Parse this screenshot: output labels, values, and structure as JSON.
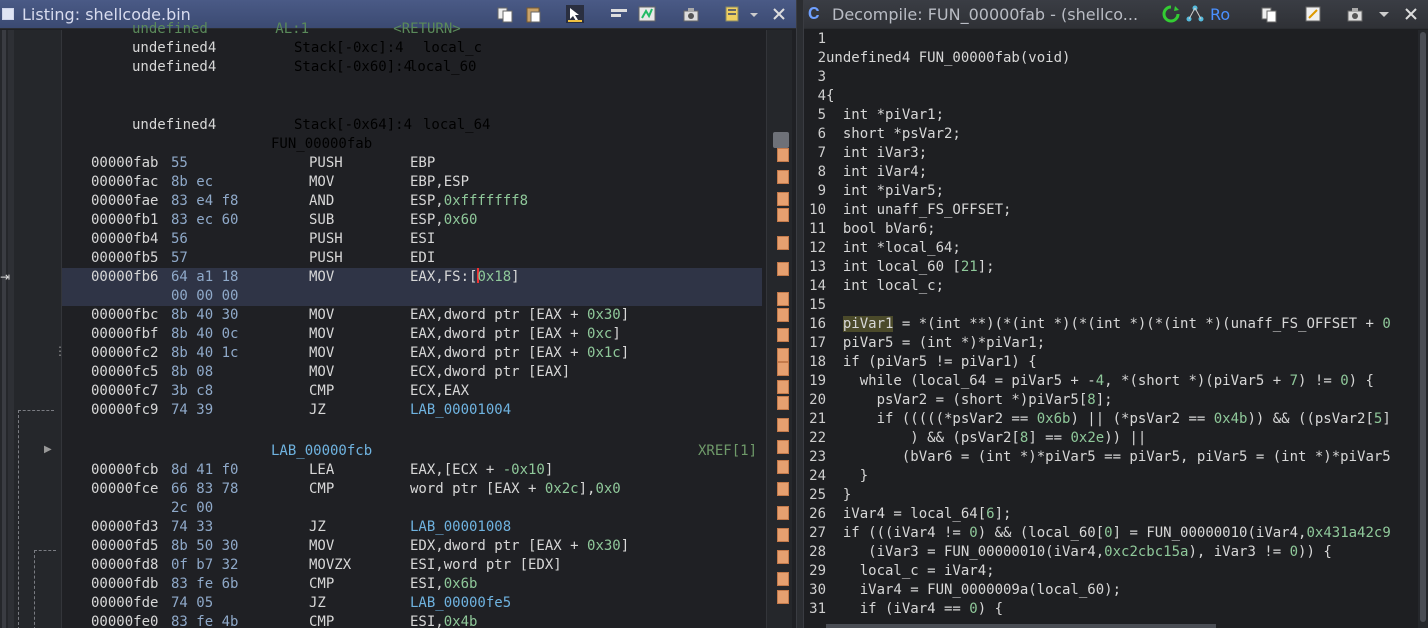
{
  "listing": {
    "title": "Listing:  shellcode.bin",
    "header_lines": [
      {
        "type": "undefined4",
        "storage": "Stack[-0xc]:4",
        "name": "local_c"
      },
      {
        "type": "undefined4",
        "storage": "Stack[-0x60]:4",
        "name": "local_60"
      },
      {
        "type": "undefined4",
        "storage": "Stack[-0x64]:4",
        "name": "local_64"
      }
    ],
    "function_label": "FUN_00000fab",
    "rows": [
      {
        "addr": "00000fab",
        "bytes": "55",
        "mn": "PUSH",
        "ops": "EBP"
      },
      {
        "addr": "00000fac",
        "bytes": "8b ec",
        "mn": "MOV",
        "ops": "EBP,ESP"
      },
      {
        "addr": "00000fae",
        "bytes": "83 e4 f8",
        "mn": "AND",
        "ops": "ESP,0xfffffff8"
      },
      {
        "addr": "00000fb1",
        "bytes": "83 ec 60",
        "mn": "SUB",
        "ops": "ESP,0x60"
      },
      {
        "addr": "00000fb4",
        "bytes": "56",
        "mn": "PUSH",
        "ops": "ESI"
      },
      {
        "addr": "00000fb5",
        "bytes": "57",
        "mn": "PUSH",
        "ops": "EDI"
      },
      {
        "addr": "00000fb6",
        "bytes": "64 a1 18",
        "mn": "MOV",
        "ops": "EAX,FS:[0x18]"
      },
      {
        "addr": "",
        "bytes": "00 00 00",
        "mn": "",
        "ops": ""
      },
      {
        "addr": "00000fbc",
        "bytes": "8b 40 30",
        "mn": "MOV",
        "ops": "EAX,dword ptr [EAX + 0x30]"
      },
      {
        "addr": "00000fbf",
        "bytes": "8b 40 0c",
        "mn": "MOV",
        "ops": "EAX,dword ptr [EAX + 0xc]"
      },
      {
        "addr": "00000fc2",
        "bytes": "8b 40 1c",
        "mn": "MOV",
        "ops": "EAX,dword ptr [EAX + 0x1c]"
      },
      {
        "addr": "00000fc5",
        "bytes": "8b 08",
        "mn": "MOV",
        "ops": "ECX,dword ptr [EAX]"
      },
      {
        "addr": "00000fc7",
        "bytes": "3b c8",
        "mn": "CMP",
        "ops": "ECX,EAX"
      },
      {
        "addr": "00000fc9",
        "bytes": "74 39",
        "mn": "JZ",
        "ops": "LAB_00001004"
      }
    ],
    "lab_label": "LAB_00000fcb",
    "xref": "XREF[1]",
    "rows2": [
      {
        "addr": "00000fcb",
        "bytes": "8d 41 f0",
        "mn": "LEA",
        "ops": "EAX,[ECX + -0x10]"
      },
      {
        "addr": "00000fce",
        "bytes": "66 83 78",
        "mn": "CMP",
        "ops": "word ptr [EAX + 0x2c],0x0"
      },
      {
        "addr": "",
        "bytes": "2c 00",
        "mn": "",
        "ops": ""
      },
      {
        "addr": "00000fd3",
        "bytes": "74 33",
        "mn": "JZ",
        "ops": "LAB_00001008"
      },
      {
        "addr": "00000fd5",
        "bytes": "8b 50 30",
        "mn": "MOV",
        "ops": "EDX,dword ptr [EAX + 0x30]"
      },
      {
        "addr": "00000fd8",
        "bytes": "0f b7 32",
        "mn": "MOVZX",
        "ops": "ESI,word ptr [EDX]"
      },
      {
        "addr": "00000fdb",
        "bytes": "83 fe 6b",
        "mn": "CMP",
        "ops": "ESI,0x6b"
      },
      {
        "addr": "00000fde",
        "bytes": "74 05",
        "mn": "JZ",
        "ops": "LAB_00000fe5"
      },
      {
        "addr": "00000fe0",
        "bytes": "83 fe 4b",
        "mn": "CMP",
        "ops": "ESI,0x4b"
      }
    ]
  },
  "decompile": {
    "title": "Decompile: FUN_00000fab -  (shellco...",
    "ro_label": "Ro",
    "lines": [
      "",
      "undefined4 FUN_00000fab(void)",
      "",
      "{",
      "  int *piVar1;",
      "  short *psVar2;",
      "  int iVar3;",
      "  int iVar4;",
      "  int *piVar5;",
      "  int unaff_FS_OFFSET;",
      "  bool bVar6;",
      "  int *local_64;",
      "  int local_60 [21];",
      "  int local_c;",
      "",
      "  piVar1 = *(int **)(*(int *)(*(int *)(*(int *)(unaff_FS_OFFSET + 0",
      "  piVar5 = (int *)*piVar1;",
      "  if (piVar5 != piVar1) {",
      "    while (local_64 = piVar5 + -4, *(short *)(piVar5 + 7) != 0) {",
      "      psVar2 = (short *)piVar5[8];",
      "      if (((((*psVar2 == 0x6b) || (*psVar2 == 0x4b)) && ((psVar2[5]",
      "          ) && (psVar2[8] == 0x2e)) ||",
      "         (bVar6 = (int *)*piVar5 == piVar5, piVar5 = (int *)*piVar5",
      "    }",
      "  }",
      "  iVar4 = local_64[6];",
      "  if (((iVar4 != 0) && (local_60[0] = FUN_00000010(iVar4,0x431a42c9",
      "     (iVar3 = FUN_00000010(iVar4,0xc2cbc15a), iVar3 != 0)) {",
      "    local_c = iVar4;",
      "    iVar4 = FUN_0000009a(local_60);",
      "    if (iVar4 == 0) {"
    ]
  },
  "colors": {
    "accent": "#e6a070",
    "label": "#6fb3e0",
    "number": "#8fc89a"
  }
}
